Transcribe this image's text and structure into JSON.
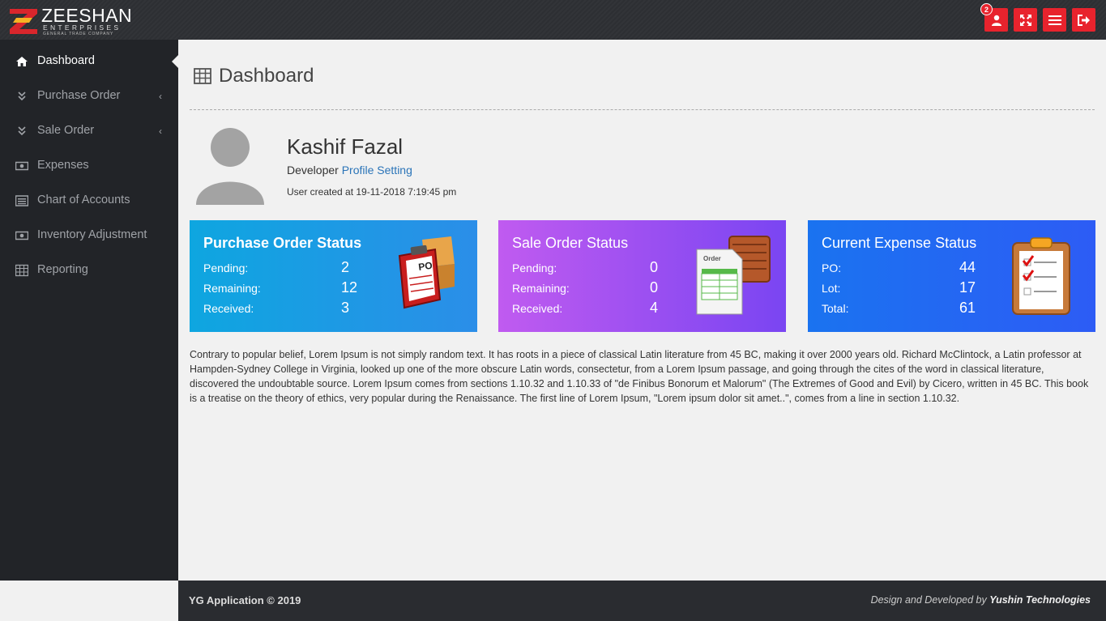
{
  "brand": {
    "name": "ZEESHAN",
    "line2": "ENTERPRISES",
    "line3": "GENERAL TRADE COMPANY"
  },
  "topbar": {
    "notification_count": "2",
    "colors": {
      "button": "#e8232d"
    },
    "buttons": [
      "user-icon",
      "fullscreen-icon",
      "menu-icon",
      "logout-icon"
    ]
  },
  "sidebar": {
    "items": [
      {
        "label": "Dashboard",
        "icon": "home-icon",
        "active": true
      },
      {
        "label": "Purchase Order",
        "icon": "double-chevron-down-icon",
        "has_children": true
      },
      {
        "label": "Sale Order",
        "icon": "double-chevron-down-icon",
        "has_children": true
      },
      {
        "label": "Expenses",
        "icon": "money-icon"
      },
      {
        "label": "Chart of Accounts",
        "icon": "list-icon"
      },
      {
        "label": "Inventory Adjustment",
        "icon": "money-icon"
      },
      {
        "label": "Reporting",
        "icon": "table-icon"
      }
    ]
  },
  "page": {
    "title": "Dashboard"
  },
  "user": {
    "name": "Kashif Fazal",
    "role": "Developer",
    "profile_link": "Profile Setting",
    "created": "User created at 19-11-2018 7:19:45 pm"
  },
  "cards": [
    {
      "title": "Purchase Order Status",
      "rows": [
        {
          "label": "Pending:",
          "value": "2"
        },
        {
          "label": "Remaining:",
          "value": "12"
        },
        {
          "label": "Received:",
          "value": "3"
        }
      ],
      "illustration_label": "PO",
      "colors": {
        "from": "#0ea6e0",
        "to": "#2b8ee8"
      }
    },
    {
      "title": "Sale Order Status",
      "rows": [
        {
          "label": "Pending:",
          "value": "0"
        },
        {
          "label": "Remaining:",
          "value": "0"
        },
        {
          "label": "Received:",
          "value": "4"
        }
      ],
      "illustration_label": "Order",
      "colors": {
        "from": "#c05bf0",
        "to": "#7a45f2"
      }
    },
    {
      "title": "Current Expense Status",
      "rows": [
        {
          "label": "PO:",
          "value": "44"
        },
        {
          "label": "Lot:",
          "value": "17"
        },
        {
          "label": "Total:",
          "value": "61"
        }
      ],
      "illustration_label": "",
      "colors": {
        "from": "#1a73f0",
        "to": "#2d5cf5"
      }
    }
  ],
  "body_text": "Contrary to popular belief, Lorem Ipsum is not simply random text. It has roots in a piece of classical Latin literature from 45 BC, making it over 2000 years old. Richard McClintock, a Latin professor at Hampden-Sydney College in Virginia, looked up one of the more obscure Latin words, consectetur, from a Lorem Ipsum passage, and going through the cites of the word in classical literature, discovered the undoubtable source. Lorem Ipsum comes from sections 1.10.32 and 1.10.33 of \"de Finibus Bonorum et Malorum\" (The Extremes of Good and Evil) by Cicero, written in 45 BC. This book is a treatise on the theory of ethics, very popular during the Renaissance. The first line of Lorem Ipsum, \"Lorem ipsum dolor sit amet..\", comes from a line in section 1.10.32.",
  "footer": {
    "left": "YG Application © 2019",
    "right_prefix": "Design and Developed by",
    "right_company": "Yushin Technologies"
  }
}
